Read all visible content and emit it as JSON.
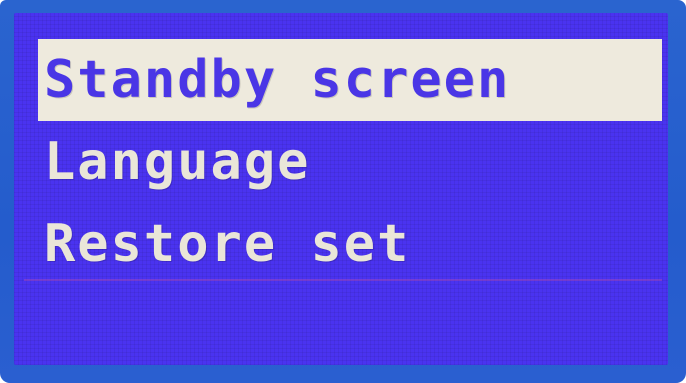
{
  "menu": {
    "items": [
      {
        "label": "Standby screen",
        "selected": true
      },
      {
        "label": "Language",
        "selected": false
      },
      {
        "label": "Restore set",
        "selected": false
      }
    ]
  },
  "colors": {
    "bezel": "#245ccc",
    "screen_background": "#4a33f0",
    "text": "#eae6d8",
    "highlight_background": "#eeeadd",
    "highlight_text": "#4a36e6"
  }
}
